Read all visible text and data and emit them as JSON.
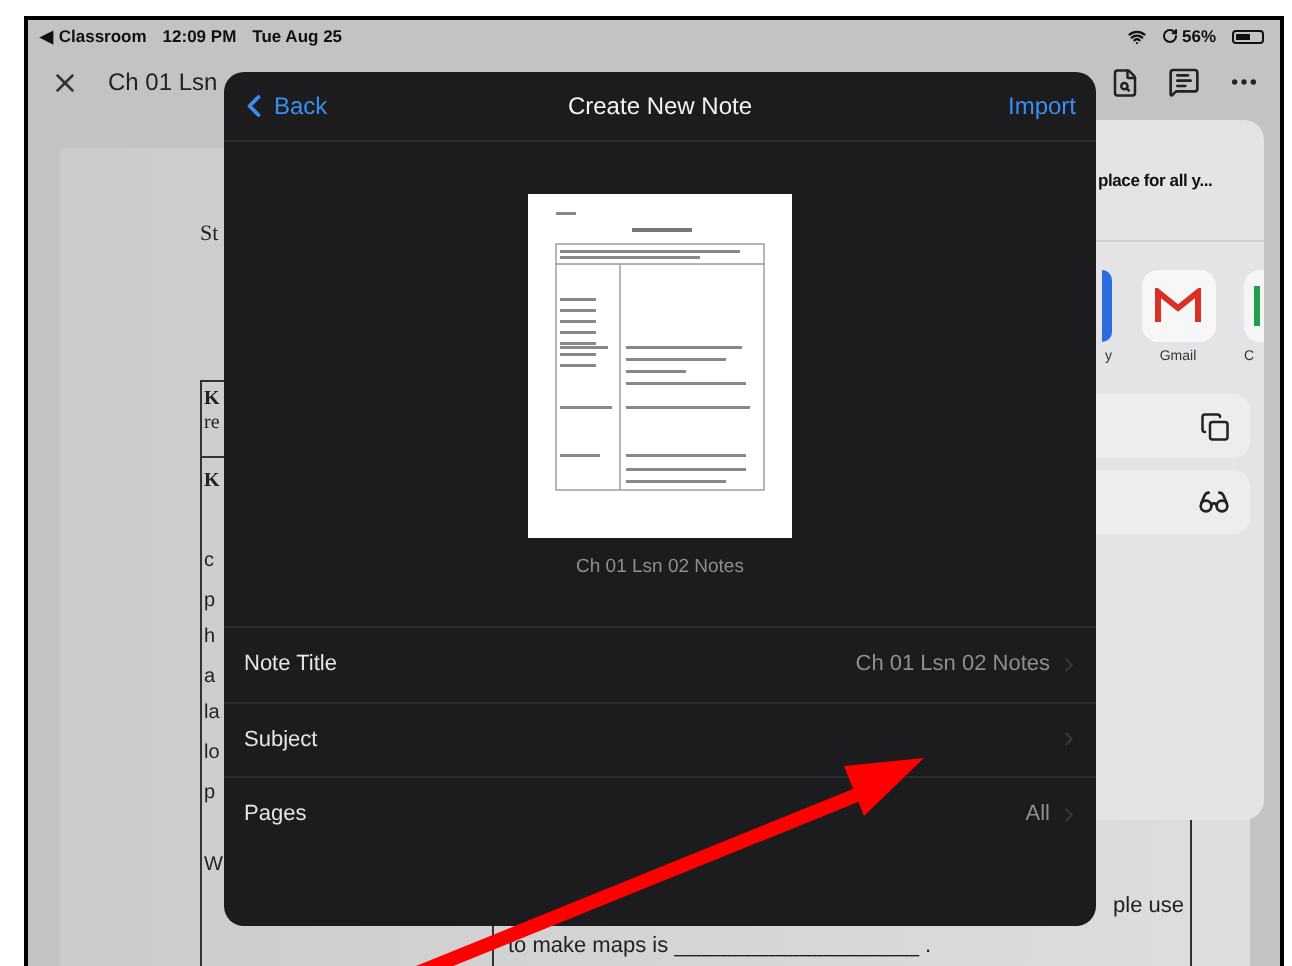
{
  "status_bar": {
    "back_app": "◀ Classroom",
    "time": "12:09 PM",
    "date": "Tue Aug 25",
    "battery": "56%"
  },
  "toolbar": {
    "document_title": "Ch 01 Lsn"
  },
  "document": {
    "student_label": "St",
    "row_1": {
      "title": "K",
      "text": "re"
    },
    "row_2": {
      "title": "K",
      "terms": [
        "c",
        "p",
        "h",
        "a",
        "la",
        "lo",
        "p"
      ],
      "question": "W",
      "answer_tail": "ple use",
      "answer_line": "to make maps is ____________________ ."
    }
  },
  "share_sheet": {
    "header": "place for all y...",
    "apps": [
      {
        "kind": "blue",
        "label": "y"
      },
      {
        "kind": "gmail",
        "label": "Gmail"
      },
      {
        "kind": "green",
        "label": "C"
      }
    ],
    "actions": [
      {
        "kind": "copy"
      },
      {
        "kind": "glasses"
      }
    ]
  },
  "modal": {
    "back": "Back",
    "title": "Create New Note",
    "import": "Import",
    "preview_caption": "Ch 01 Lsn 02 Notes",
    "rows": [
      {
        "label": "Note Title",
        "value": "Ch 01 Lsn 02 Notes"
      },
      {
        "label": "Subject"
      },
      {
        "label": "Pages",
        "value": "All"
      }
    ]
  }
}
